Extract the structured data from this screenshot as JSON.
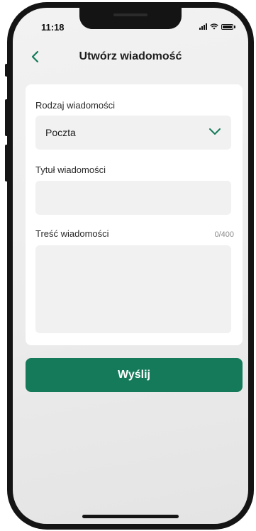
{
  "status_bar": {
    "time": "11:18"
  },
  "header": {
    "title": "Utwórz wiadomość"
  },
  "form": {
    "type_label": "Rodzaj wiadomości",
    "type_value": "Poczta",
    "title_label": "Tytuł wiadomości",
    "title_value": "",
    "body_label": "Treść wiadomości",
    "body_value": "",
    "body_counter": "0/400"
  },
  "actions": {
    "send_label": "Wyślij"
  },
  "colors": {
    "accent": "#147a5a",
    "card_background": "#ffffff",
    "field_background": "#f1f1f1",
    "screen_background": "#ececec"
  },
  "icons": [
    "back-chevron-icon",
    "chevron-down-icon",
    "signal-icon",
    "wifi-icon",
    "battery-icon"
  ]
}
